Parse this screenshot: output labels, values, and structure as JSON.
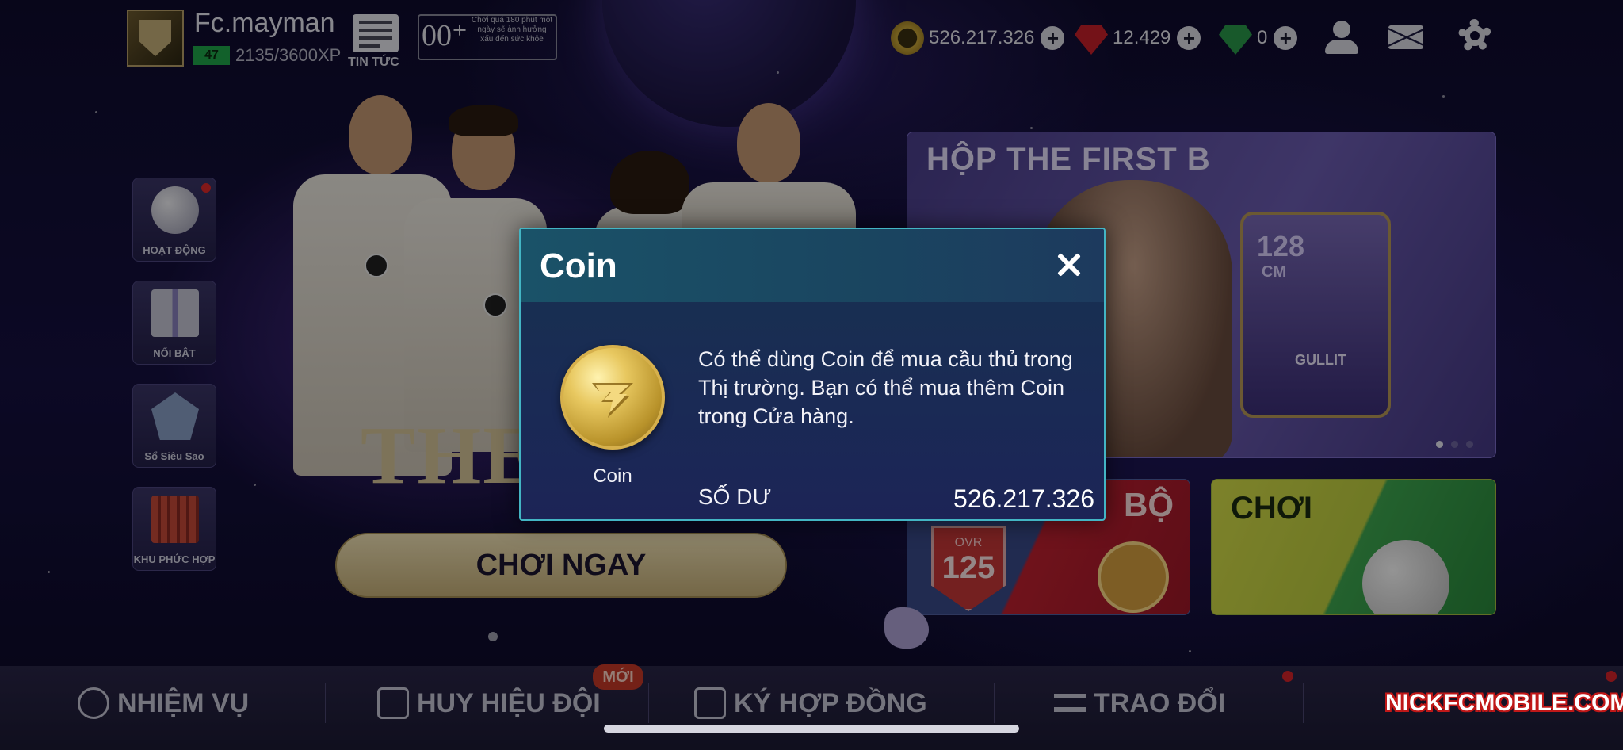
{
  "profile": {
    "username": "Fc.mayman",
    "level": "47",
    "xp": "2135/3600XP",
    "news_label": "TIN TỨC",
    "age_rating": "00⁺",
    "age_note": "Chơi quá 180 phút một ngày sẽ ảnh hưởng xấu đến sức khỏe"
  },
  "currencies": [
    {
      "name": "coin",
      "value": "526.217.326",
      "color": "#c9a638"
    },
    {
      "name": "gem",
      "value": "12.429",
      "color": "#c8202a"
    },
    {
      "name": "token",
      "value": "0",
      "color": "#2a9a4a"
    }
  ],
  "left_menu": [
    {
      "label": "HOẠT ĐỘNG",
      "icon": "ball-icon",
      "notify": true
    },
    {
      "label": "NỔI BẬT",
      "icon": "gift-icon",
      "notify": false
    },
    {
      "label": "Sổ Siêu Sao",
      "icon": "star-shield-icon",
      "notify": false
    },
    {
      "label": "KHU PHỨC HỢP",
      "icon": "stadium-icon",
      "notify": false
    }
  ],
  "hero": {
    "big_text": "THE",
    "play_button": "CHƠI NGAY"
  },
  "promo": {
    "title": "HỘP THE FIRST B",
    "card_ovr": "128",
    "card_position": "CM",
    "card_name": "GULLIT"
  },
  "club_card": {
    "title": "BỘ",
    "ovr_label": "OVR",
    "ovr_value": "125"
  },
  "play_card": {
    "title": "CHƠI"
  },
  "bottom_nav": [
    {
      "label": "NHIỆM VỤ",
      "icon": "target-icon"
    },
    {
      "label": "HUY HIỆU ĐỘI",
      "icon": "team-badge-icon",
      "badge": "MỚI"
    },
    {
      "label": "KÝ HỢP ĐỒNG",
      "icon": "contract-icon"
    },
    {
      "label": "TRAO ĐỔI",
      "icon": "exchange-icon"
    }
  ],
  "watermark": "NICKFCMOBILE.COM",
  "modal": {
    "title": "Coin",
    "coin_label": "Coin",
    "description": "Có thể dùng Coin để mua cầu thủ trong Thị trường. Bạn có thể mua thêm Coin trong Cửa hàng.",
    "balance_label": "SỐ DƯ",
    "balance_value": "526.217.326"
  }
}
